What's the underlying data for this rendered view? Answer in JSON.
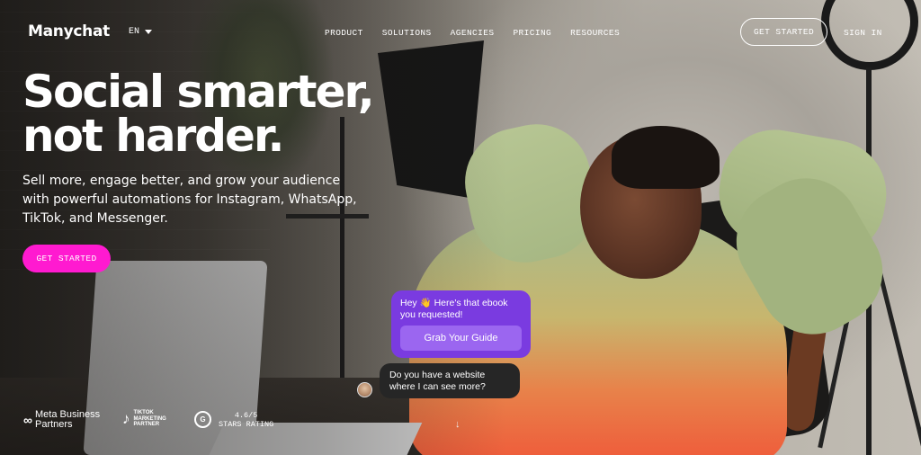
{
  "header": {
    "logo": "Manychat",
    "language": "EN",
    "nav": [
      "PRODUCT",
      "SOLUTIONS",
      "AGENCIES",
      "PRICING",
      "RESOURCES"
    ],
    "get_started": "GET STARTED",
    "sign_in": "SIGN IN"
  },
  "hero": {
    "headline_line1": "Social smarter,",
    "headline_line2": "not harder.",
    "subtext": "Sell more, engage better, and grow your audience with powerful automations for Instagram, WhatsApp, TikTok, and Messenger.",
    "cta": "GET STARTED"
  },
  "chat": {
    "bot_message": "Hey 👋 Here's that ebook you requested!",
    "bot_button": "Grab Your Guide",
    "user_message": "Do you have a website where I can see more?"
  },
  "badges": {
    "meta_line1": "Meta Business",
    "meta_line2": "Partners",
    "tiktok_line1": "TIKTOK",
    "tiktok_line2": "MARKETING",
    "tiktok_line3": "PARTNER",
    "rating_value": "4.6/5",
    "rating_label": "STARS RATING"
  },
  "colors": {
    "cta_pink": "#ff1ad0",
    "bubble_purple": "#7a3be0",
    "bubble_button": "#9b66f0",
    "bubble_dark": "#262626"
  },
  "icons": [
    "caret-down-icon",
    "meta-logo-icon",
    "tiktok-logo-icon",
    "g2-logo-icon",
    "scroll-down-arrow-icon"
  ]
}
